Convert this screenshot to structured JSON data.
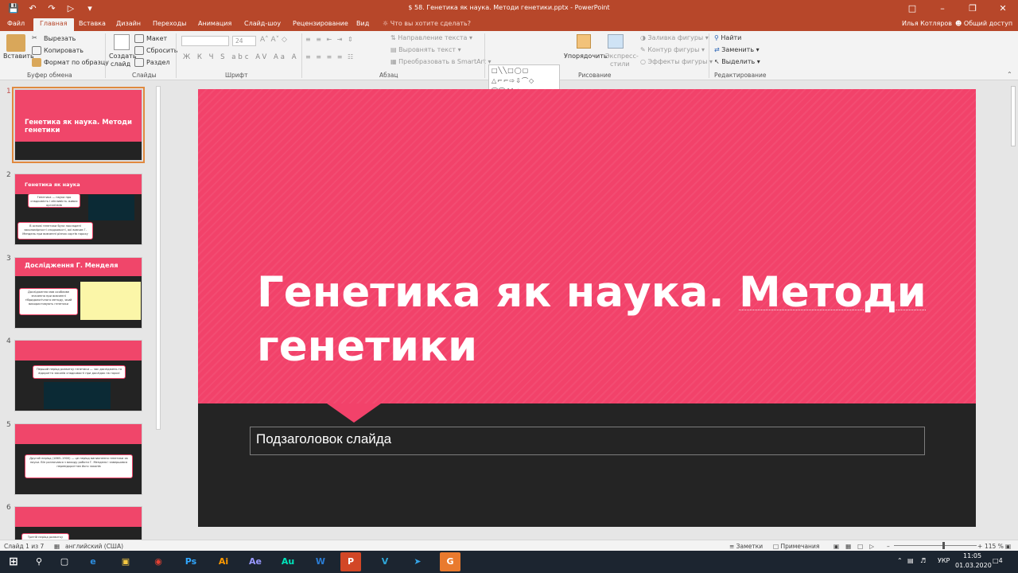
{
  "window": {
    "title": "$ 58. Генетика як наука. Методи генетики.pptx - PowerPoint",
    "user_name": "Илья Котляров",
    "share_label": "Общий доступ"
  },
  "ribbon_tabs": [
    "Файл",
    "Главная",
    "Вставка",
    "Дизайн",
    "Переходы",
    "Анимация",
    "Слайд-шоу",
    "Рецензирование",
    "Вид"
  ],
  "tell_me": "Что вы хотите сделать?",
  "ribbon": {
    "clipboard": {
      "paste": "Вставить",
      "cut": "Вырезать",
      "copy": "Копировать",
      "format_painter": "Формат по образцу",
      "label": "Буфер обмена"
    },
    "slides": {
      "new_slide_1": "Создать",
      "new_slide_2": "слайд",
      "layout": "Макет",
      "reset": "Сбросить",
      "section": "Раздел",
      "label": "Слайды"
    },
    "font": {
      "size": "24",
      "label": "Шрифт"
    },
    "paragraph": {
      "text_direction": "Направление текста",
      "align_text": "Выровнять текст",
      "smartart": "Преобразовать в SmartArt",
      "label": "Абзац"
    },
    "drawing": {
      "arrange": "Упорядочить",
      "quick_styles_1": "Экспресс-",
      "quick_styles_2": "стили",
      "shape_fill": "Заливка фигуры",
      "shape_outline": "Контур фигуры",
      "shape_effects": "Эффекты фигуры",
      "label": "Рисование"
    },
    "editing": {
      "find": "Найти",
      "replace": "Заменить",
      "select": "Выделить",
      "label": "Редактирование"
    }
  },
  "thumbnails": [
    {
      "num": "1",
      "title": "Генетика як наука. Методи генетики"
    },
    {
      "num": "2",
      "title": "Генетика як наука",
      "card1": "Генетика — наука про спадковість і мінливість живих організмів",
      "card2": "В основі генетики були покладені закономірності спадковості, які вивчав Г. Мендель при вивченні різних сортів гороху"
    },
    {
      "num": "3",
      "title": "Дослідження Г. Менделя",
      "card1": "Дослідження мав особливе значення при вивченні гібридологічного методу, який використовують генетики"
    },
    {
      "num": "4",
      "card1": "Перший період розвитку генетики — час досліджень та відкриття законів спадковості при дослідах на горосі"
    },
    {
      "num": "5",
      "card1": "Другий період (1865–1900) — це період виникнення генетики як науки. Він розпочався з виходу роботи Г. Менделя і завершився перевідкриттям його законів"
    },
    {
      "num": "6",
      "card1": "Третій період розвитку"
    }
  ],
  "slide": {
    "title_line1_a": "Генетика як наука. ",
    "title_line1_b": "Методи",
    "title_line2": "генетики",
    "subtitle": "Подзаголовок слайда"
  },
  "status": {
    "slide_info": "Слайд 1 из 7",
    "language": "английский (США)",
    "notes": "Заметки",
    "comments": "Примечания",
    "zoom": "115 %"
  },
  "tray": {
    "lang": "УКР",
    "time": "11:05",
    "date": "01.03.2020",
    "notif_count": "4"
  },
  "taskbar_apps": [
    "Ps",
    "Ai",
    "Ae",
    "Au",
    "W",
    "P",
    "V"
  ]
}
